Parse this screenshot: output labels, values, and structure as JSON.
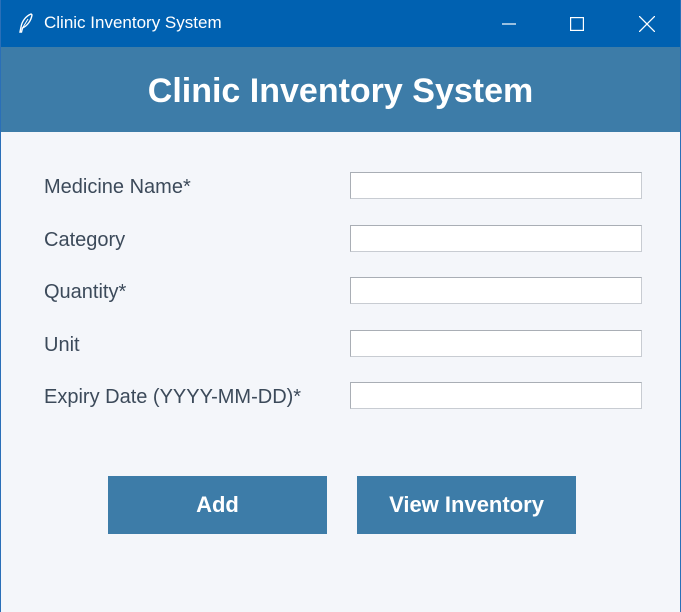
{
  "window": {
    "title": "Clinic Inventory System",
    "controls": [
      "minimize-icon",
      "maximize-icon",
      "close-icon"
    ]
  },
  "header": {
    "title": "Clinic Inventory System"
  },
  "form": {
    "fields": [
      {
        "label": "Medicine Name*",
        "value": ""
      },
      {
        "label": "Category",
        "value": ""
      },
      {
        "label": "Quantity*",
        "value": ""
      },
      {
        "label": "Unit",
        "value": ""
      },
      {
        "label": "Expiry Date (YYYY-MM-DD)*",
        "value": ""
      }
    ]
  },
  "buttons": {
    "add_label": "Add",
    "view_label": "View Inventory"
  },
  "colors": {
    "titlebar": "#0061b1",
    "accent": "#3d7ca8",
    "background": "#f4f6fa"
  }
}
